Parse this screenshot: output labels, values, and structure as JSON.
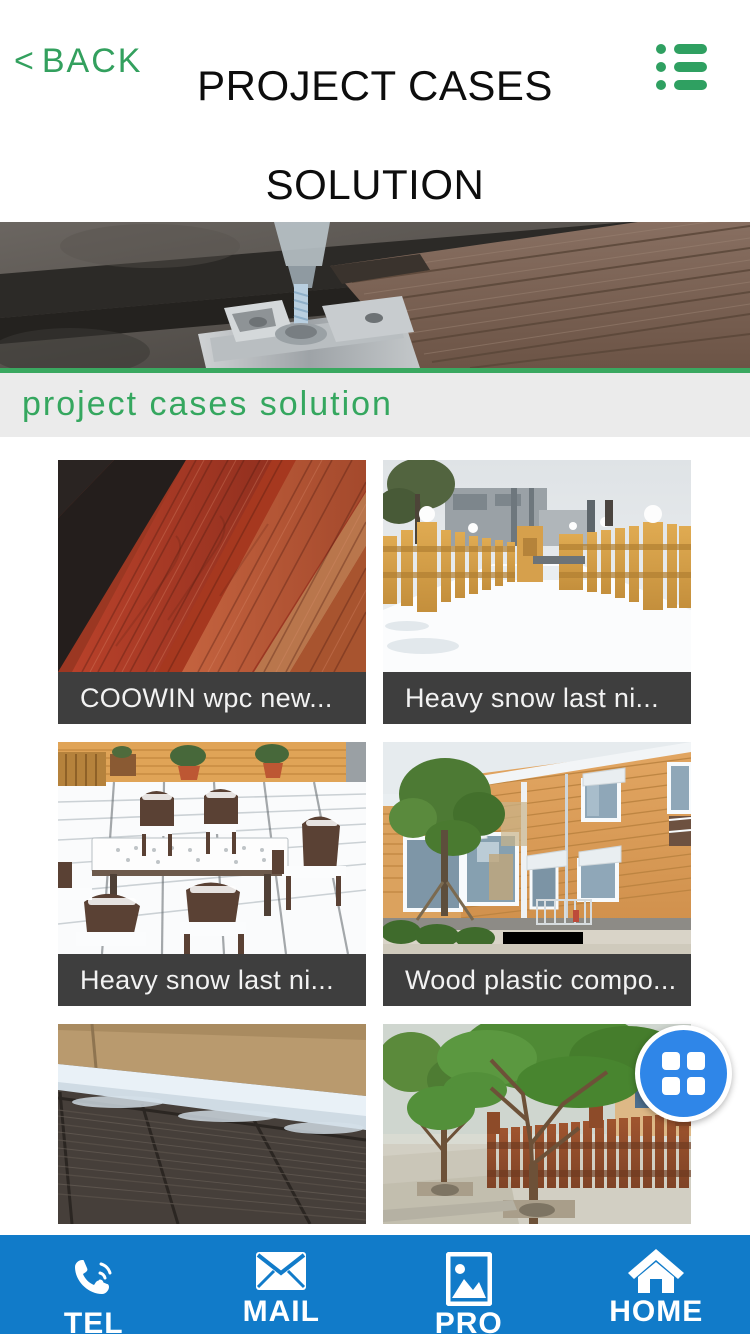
{
  "header": {
    "back_label": "BACK",
    "back_chevron": "<",
    "title_line1": "PROJECT CASES",
    "title_line2": "SOLUTION",
    "menu_icon": "list-menu-icon",
    "accent_green": "#2fa061"
  },
  "banner": {
    "alt": "close-up of wpc decking board installation with stainless steel clip and screw",
    "divider_color": "#3aa860"
  },
  "section": {
    "title": "project cases solution",
    "background": "#ebebeb",
    "text_color": "#35a75f"
  },
  "grid": {
    "cards": [
      {
        "caption": "COOWIN wpc new...",
        "image": "red-wpc-decking-boards"
      },
      {
        "caption": "Heavy snow last ni...",
        "image": "snowy-path-yellow-picket-fence"
      },
      {
        "caption": "Heavy snow last ni...",
        "image": "snow-covered-patio-furniture-deck"
      },
      {
        "caption": "Wood plastic compo...",
        "image": "tan-wpc-wall-cladding-building"
      },
      {
        "caption": "",
        "image": "dark-grey-decking-with-snow"
      },
      {
        "caption": "",
        "image": "brown-picket-fence-with-trees"
      }
    ],
    "caption_bar_color": "#3e3e3e"
  },
  "fab": {
    "icon": "grid-tiles-icon",
    "color": "#2f86e8"
  },
  "bottom_nav": {
    "background": "#117bc9",
    "items": [
      {
        "label": "TEL",
        "icon": "phone-icon"
      },
      {
        "label": "MAIL",
        "icon": "envelope-icon"
      },
      {
        "label": "PRO",
        "icon": "image-icon"
      },
      {
        "label": "HOME",
        "icon": "home-icon"
      }
    ]
  }
}
